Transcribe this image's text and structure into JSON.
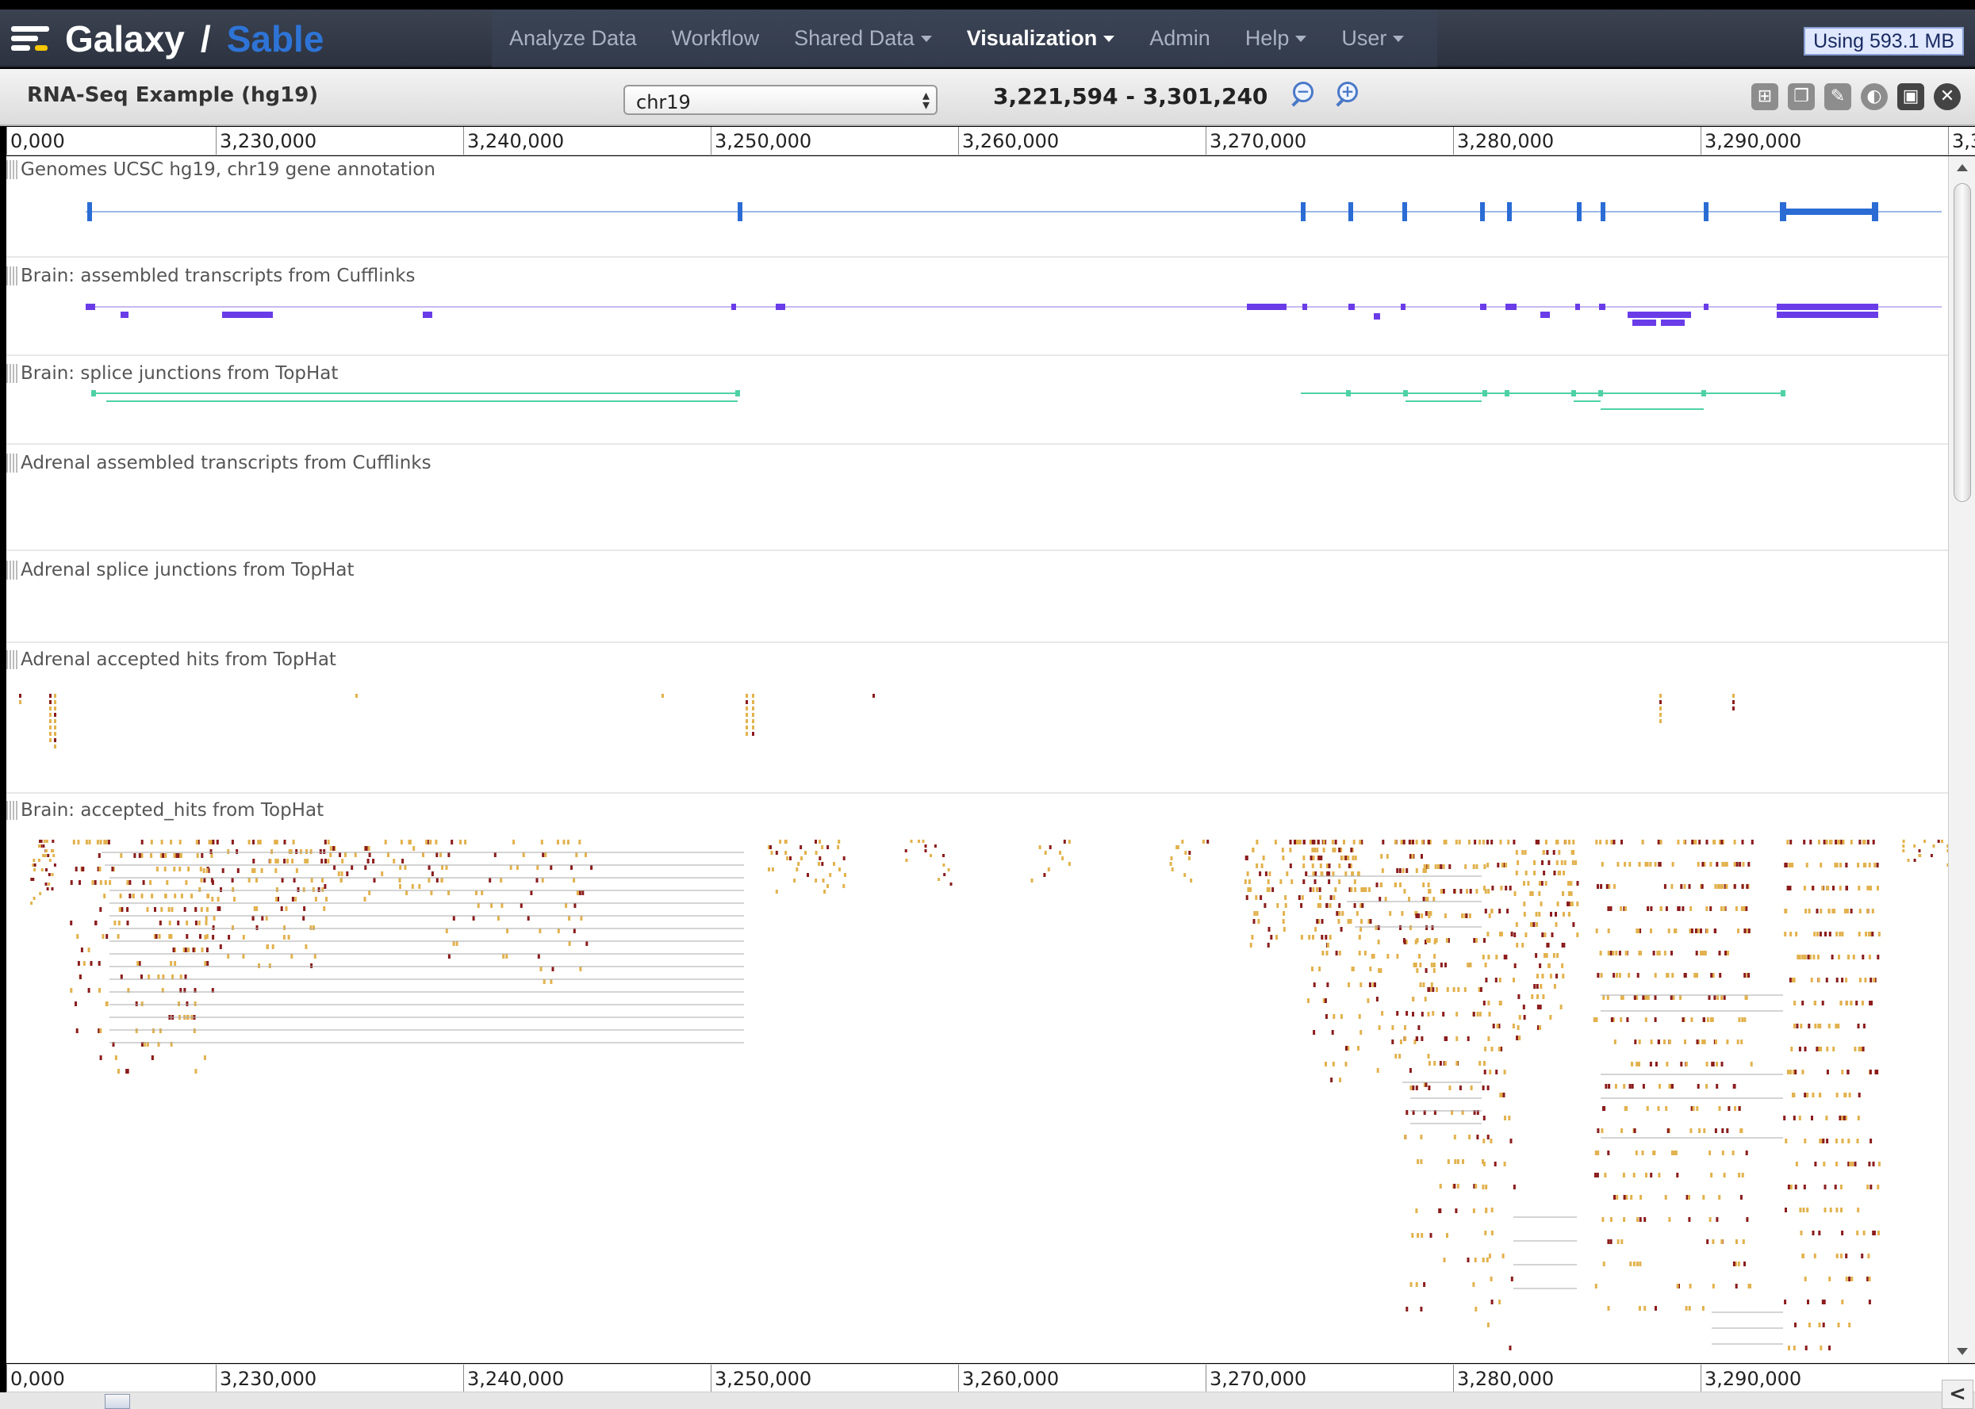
{
  "masthead": {
    "brand": "Galaxy",
    "separator": "/",
    "brand_sub": "Sable",
    "nav": [
      {
        "label": "Analyze Data",
        "dropdown": false,
        "active": false
      },
      {
        "label": "Workflow",
        "dropdown": false,
        "active": false
      },
      {
        "label": "Shared Data",
        "dropdown": true,
        "active": false
      },
      {
        "label": "Visualization",
        "dropdown": true,
        "active": true
      },
      {
        "label": "Admin",
        "dropdown": false,
        "active": false
      },
      {
        "label": "Help",
        "dropdown": true,
        "active": false
      },
      {
        "label": "User",
        "dropdown": true,
        "active": false
      }
    ],
    "quota": "Using 593.1 MB"
  },
  "toolbar": {
    "title": "RNA-Seq Example (hg19)",
    "chrom": "chr19",
    "location": "3,221,594 - 3,301,240",
    "zoom_out": "−",
    "zoom_in": "+",
    "icons": [
      "add-tracks-icon",
      "bookmarks-icon",
      "edit-icon",
      "circster-icon",
      "save-icon",
      "close-icon"
    ]
  },
  "ruler": {
    "ticks": [
      "0,000",
      "3,230,000",
      "3,240,000",
      "3,250,000",
      "3,260,000",
      "3,270,000",
      "3,280,000",
      "3,290,000",
      "3,3"
    ]
  },
  "tracks": [
    {
      "name": "Genomes UCSC hg19, chr19 gene annotation",
      "color": "#2a6cd4"
    },
    {
      "name": "Brain: assembled transcripts from Cufflinks",
      "color": "#6a3ce8"
    },
    {
      "name": "Brain: splice junctions from TopHat",
      "color": "#4fd1a6"
    },
    {
      "name": "Adrenal assembled transcripts from Cufflinks",
      "color": "#6a3ce8"
    },
    {
      "name": "Adrenal splice junctions from TopHat",
      "color": "#4fd1a6"
    },
    {
      "name": "Adrenal accepted hits from TopHat",
      "color": "#c9a24a"
    },
    {
      "name": "Brain: accepted_hits from TopHat",
      "color": "#8b1c1c"
    }
  ],
  "colors": {
    "gene": "#2a6cd4",
    "transcript": "#6a3ce8",
    "junction": "#4fd1a6",
    "read_light": "#e2b24e",
    "read_dark": "#8b1c1c"
  }
}
